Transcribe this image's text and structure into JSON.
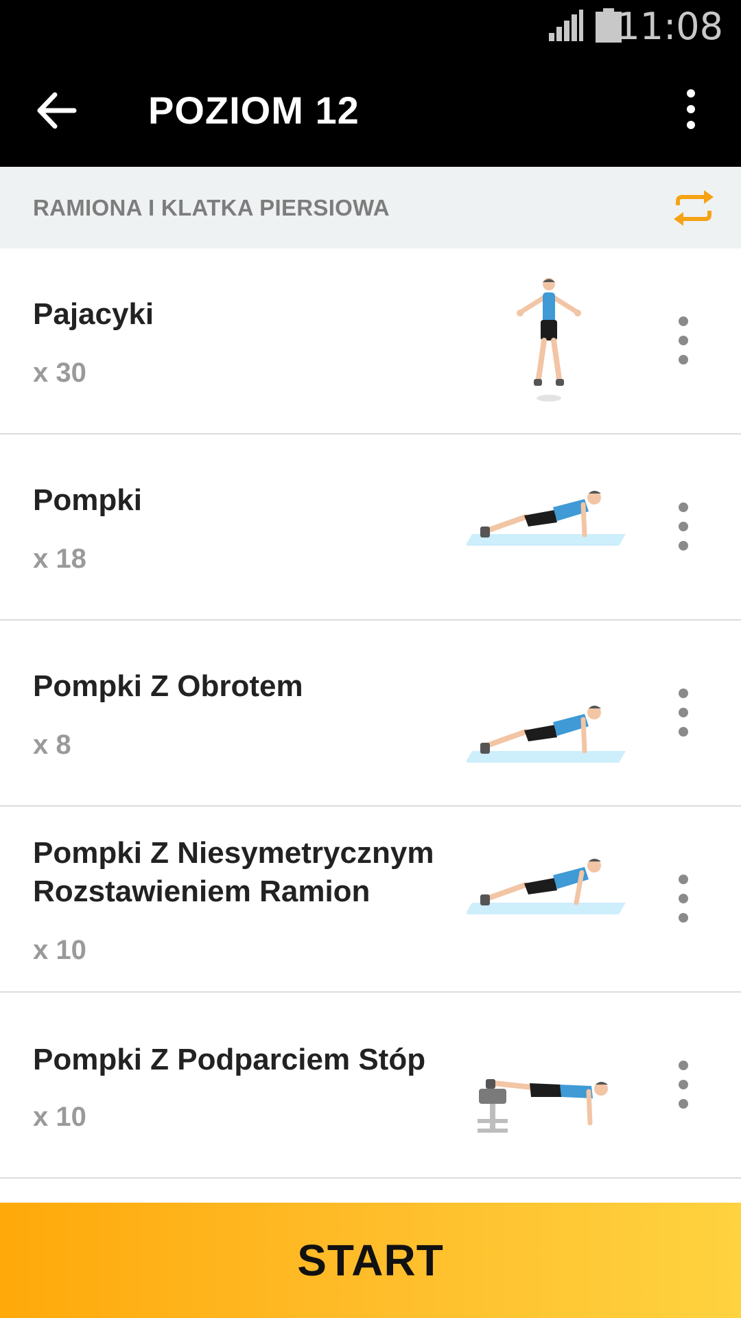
{
  "status_bar": {
    "time": "11:08",
    "signal_icon": "signal-icon",
    "battery_icon": "battery-icon"
  },
  "toolbar": {
    "title": "POZIOM 12",
    "back_icon": "arrow-left-icon",
    "menu_icon": "more-vertical-icon"
  },
  "section": {
    "label": "RAMIONA I KLATKA PIERSIOWA",
    "action_icon": "repeat-icon",
    "accent_color": "#f5a315"
  },
  "exercises": [
    {
      "name_lines": [
        "Pajacyki"
      ],
      "reps": "x 30",
      "illustration": "jumping-jacks-figure"
    },
    {
      "name_lines": [
        "Pompki"
      ],
      "reps": "x 18",
      "illustration": "push-up-figure"
    },
    {
      "name_lines": [
        "Pompki Z Obrotem"
      ],
      "reps": "x 8",
      "illustration": "push-up-figure"
    },
    {
      "name_lines": [
        "Pompki Z Niesymetrycznym",
        "Rozstawieniem Ramion"
      ],
      "reps": "x 10",
      "illustration": "push-up-figure"
    },
    {
      "name_lines": [
        "Pompki Z Podparciem Stóp"
      ],
      "reps": "x 10",
      "illustration": "decline-push-up-figure"
    }
  ],
  "start_button": {
    "label": "START",
    "gradient_from": "#ffa90a",
    "gradient_to": "#ffd23f"
  }
}
